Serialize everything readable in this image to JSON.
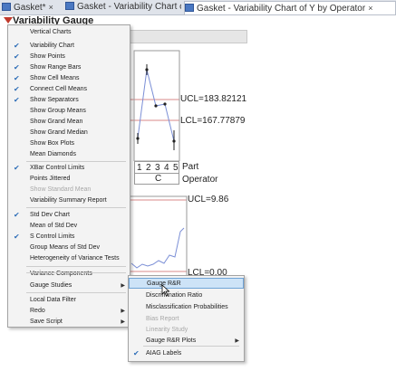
{
  "tabs": [
    {
      "label": "Gasket*",
      "close": "×"
    },
    {
      "label": "Gasket - Variability Chart of Y",
      "close": "×"
    },
    {
      "label": "Gasket - Variability Chart of Y by Operator",
      "close": "×"
    }
  ],
  "report": {
    "title": "Variability Gauge"
  },
  "xbar_chart": {
    "ucl_label": "UCL=183.82121",
    "lcl_label": "LCL=167.77879",
    "part_ticks": [
      "1",
      "2",
      "3",
      "4",
      "5"
    ],
    "part_axis_label": "Part",
    "operator_value": "C",
    "operator_axis_label": "Operator"
  },
  "std_chart": {
    "ucl_label": "UCL=9.86",
    "lcl_label": "LCL=0.00"
  },
  "menu": {
    "items": [
      {
        "label": "Vertical Charts",
        "checked": false,
        "submenu": false,
        "disabled": false
      },
      {
        "label": "Variability Chart",
        "checked": true,
        "submenu": false,
        "disabled": false
      },
      {
        "label": "Show Points",
        "checked": true,
        "submenu": false,
        "disabled": false
      },
      {
        "label": "Show Range Bars",
        "checked": true,
        "submenu": false,
        "disabled": false
      },
      {
        "label": "Show Cell Means",
        "checked": true,
        "submenu": false,
        "disabled": false
      },
      {
        "label": "Connect Cell Means",
        "checked": true,
        "submenu": false,
        "disabled": false
      },
      {
        "label": "Show Separators",
        "checked": true,
        "submenu": false,
        "disabled": false
      },
      {
        "label": "Show Group Means",
        "checked": false,
        "submenu": false,
        "disabled": false
      },
      {
        "label": "Show Grand Mean",
        "checked": false,
        "submenu": false,
        "disabled": false
      },
      {
        "label": "Show Grand Median",
        "checked": false,
        "submenu": false,
        "disabled": false
      },
      {
        "label": "Show Box Plots",
        "checked": false,
        "submenu": false,
        "disabled": false
      },
      {
        "label": "Mean Diamonds",
        "checked": false,
        "submenu": false,
        "disabled": false
      },
      {
        "label": "XBar Control Limits",
        "checked": true,
        "submenu": false,
        "disabled": false
      },
      {
        "label": "Points Jittered",
        "checked": false,
        "submenu": false,
        "disabled": false
      },
      {
        "label": "Show Standard Mean",
        "checked": false,
        "submenu": false,
        "disabled": true
      },
      {
        "label": "Variability Summary Report",
        "checked": false,
        "submenu": false,
        "disabled": false
      },
      {
        "label": "Std Dev Chart",
        "checked": true,
        "submenu": false,
        "disabled": false
      },
      {
        "label": "Mean of Std Dev",
        "checked": false,
        "submenu": false,
        "disabled": false
      },
      {
        "label": "S Control Limits",
        "checked": true,
        "submenu": false,
        "disabled": false
      },
      {
        "label": "Group Means of Std Dev",
        "checked": false,
        "submenu": false,
        "disabled": false
      },
      {
        "label": "Heterogeneity of Variance Tests",
        "checked": false,
        "submenu": false,
        "disabled": false
      },
      {
        "label": "Variance Components",
        "checked": false,
        "submenu": false,
        "disabled": false
      },
      {
        "label": "Gauge Studies",
        "checked": false,
        "submenu": true,
        "disabled": false
      },
      {
        "label": "Local Data Filter",
        "checked": false,
        "submenu": false,
        "disabled": false
      },
      {
        "label": "Redo",
        "checked": false,
        "submenu": true,
        "disabled": false
      },
      {
        "label": "Save Script",
        "checked": false,
        "submenu": true,
        "disabled": false
      }
    ]
  },
  "submenu": {
    "items": [
      {
        "label": "Gauge R&R",
        "checked": false,
        "submenu": false,
        "disabled": false,
        "highlighted": true
      },
      {
        "label": "Discrimination Ratio",
        "checked": false,
        "submenu": false,
        "disabled": false,
        "highlighted": false
      },
      {
        "label": "Misclassification Probabilities",
        "checked": false,
        "submenu": false,
        "disabled": false,
        "highlighted": false
      },
      {
        "label": "Bias Report",
        "checked": false,
        "submenu": false,
        "disabled": true,
        "highlighted": false
      },
      {
        "label": "Linearity Study",
        "checked": false,
        "submenu": false,
        "disabled": true,
        "highlighted": false
      },
      {
        "label": "Gauge R&R Plots",
        "checked": false,
        "submenu": true,
        "disabled": false,
        "highlighted": false
      },
      {
        "label": "AIAG Labels",
        "checked": true,
        "submenu": false,
        "disabled": false,
        "highlighted": false
      }
    ]
  },
  "glyphs": {
    "check": "✔",
    "submenu_arrow": "▶"
  },
  "colors": {
    "limit_line": "#d98a8a",
    "series_line": "#7b8fd6",
    "check": "#2f6fb8",
    "highlight": "#cde3f7"
  }
}
